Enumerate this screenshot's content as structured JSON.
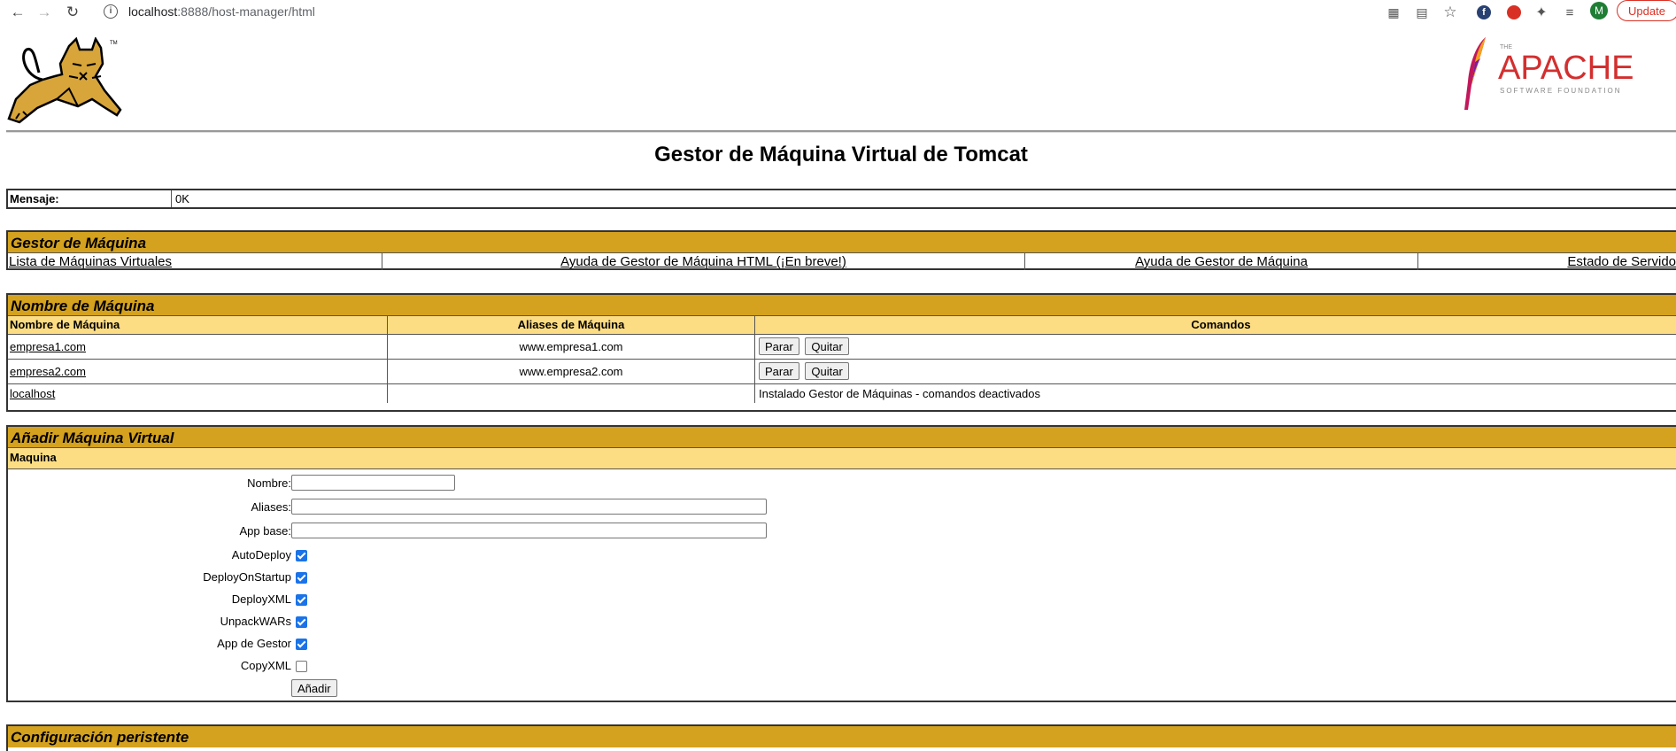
{
  "browser": {
    "url_host": "localhost",
    "url_rest": ":8888/host-manager/html",
    "update_label": "Update",
    "avatar_letter": "M"
  },
  "page": {
    "title": "Gestor de Máquina Virtual de Tomcat",
    "apache": {
      "small_top": "THE",
      "name": "APACHE",
      "sub": "SOFTWARE FOUNDATION"
    },
    "tomcat_tm": "TM"
  },
  "message": {
    "label": "Mensaje:",
    "value": "0K"
  },
  "manager": {
    "header": "Gestor de Máquina",
    "links": [
      "Lista de Máquinas Virtuales",
      "Ayuda de Gestor de Máquina HTML (¡En breve!)",
      "Ayuda de Gestor de Máquina",
      "Estado de Servidor"
    ]
  },
  "hosts": {
    "header": "Nombre de Máquina",
    "columns": [
      "Nombre de Máquina",
      "Aliases de Máquina",
      "Comandos"
    ],
    "rows": [
      {
        "name": "empresa1.com",
        "alias": "www.empresa1.com",
        "stop": "Parar",
        "remove": "Quitar"
      },
      {
        "name": "empresa2.com",
        "alias": "www.empresa2.com",
        "stop": "Parar",
        "remove": "Quitar"
      },
      {
        "name": "localhost",
        "alias": "",
        "note": "Instalado Gestor de Máquinas - comandos deactivados"
      }
    ]
  },
  "add_host": {
    "header": "Añadir Máquina Virtual",
    "subheader": "Maquina",
    "fields": [
      {
        "label": "Nombre:",
        "value": ""
      },
      {
        "label": "Aliases:",
        "value": ""
      },
      {
        "label": "App base:",
        "value": ""
      }
    ],
    "checkboxes": [
      {
        "label": "AutoDeploy",
        "checked": true
      },
      {
        "label": "DeployOnStartup",
        "checked": true
      },
      {
        "label": "DeployXML",
        "checked": true
      },
      {
        "label": "UnpackWARs",
        "checked": true
      },
      {
        "label": "App de Gestor",
        "checked": true
      },
      {
        "label": "CopyXML",
        "checked": false
      }
    ],
    "submit_label": "Añadir"
  },
  "persistent": {
    "header": "Configuración peristente"
  }
}
